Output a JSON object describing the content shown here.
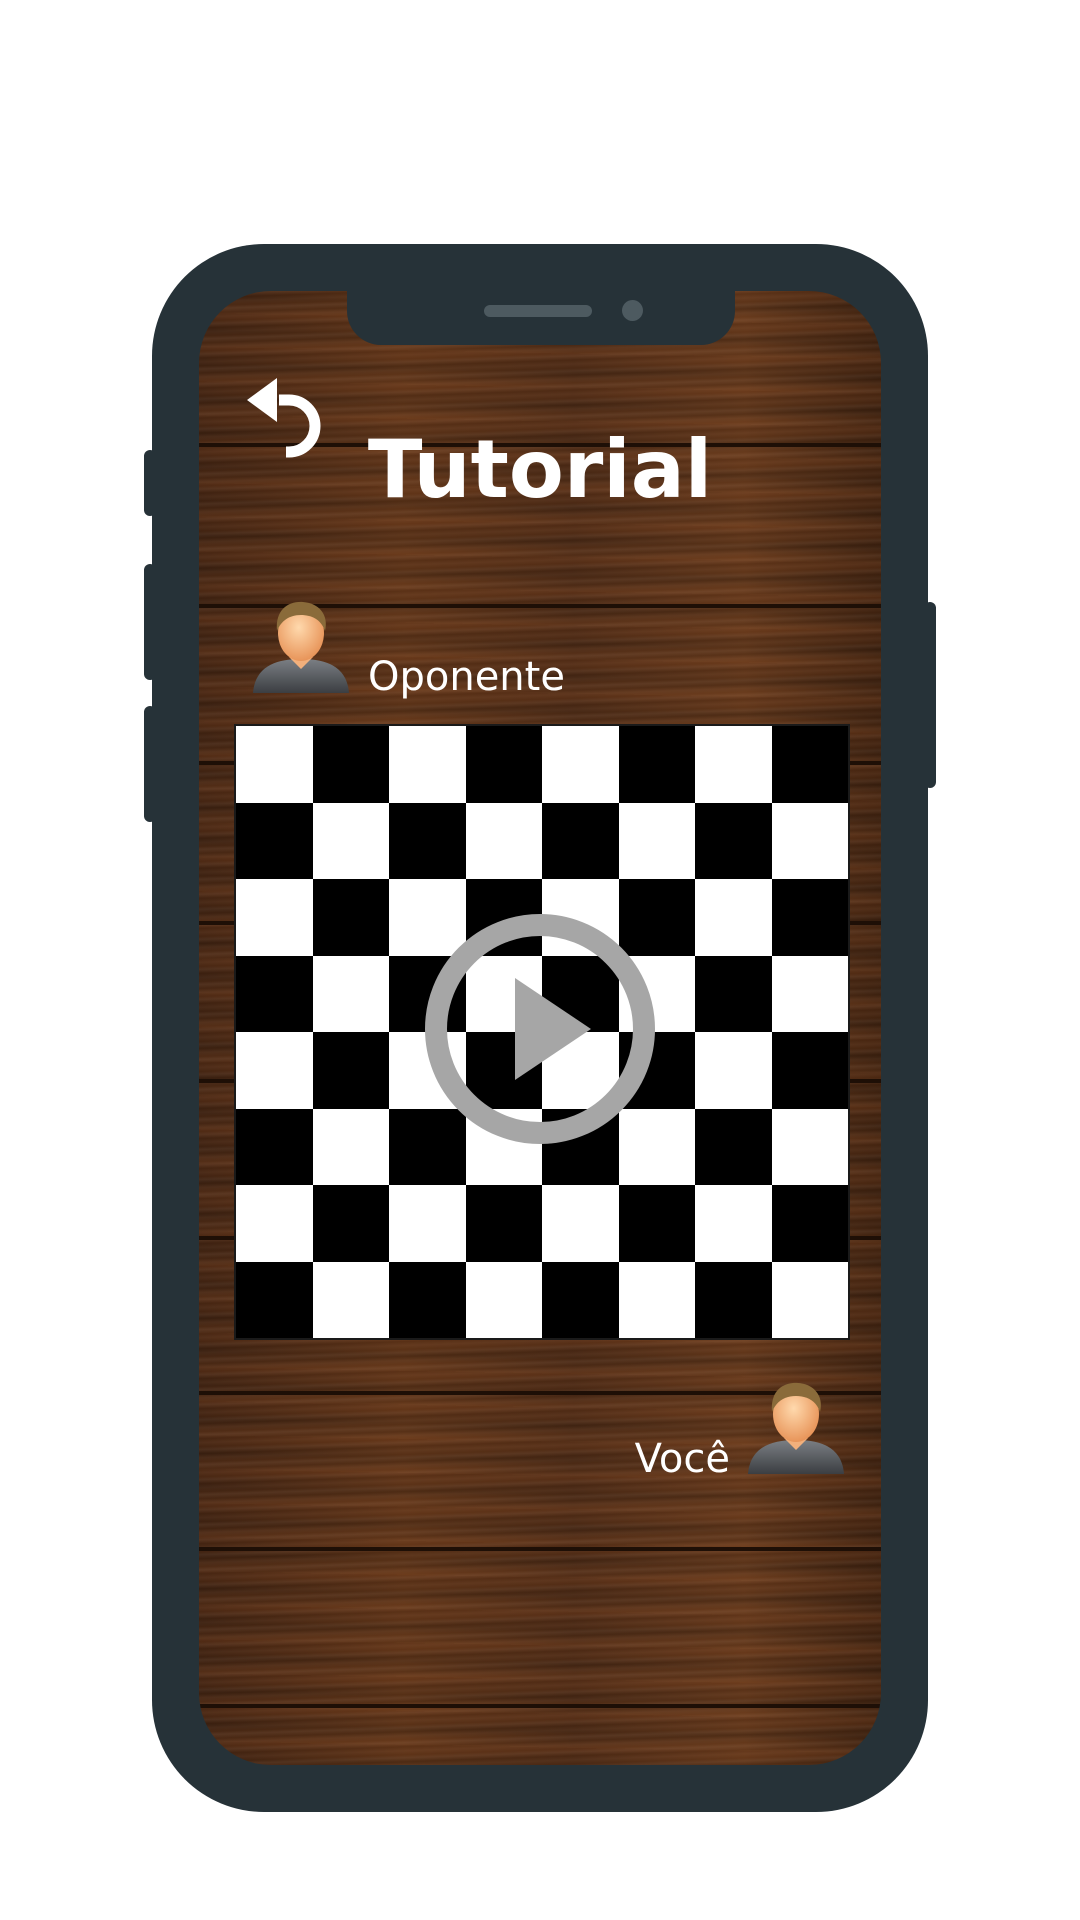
{
  "header": {
    "title": "Tutorial",
    "back_icon": "back-arrow-icon"
  },
  "players": {
    "opponent": {
      "name": "Oponente",
      "icon": "user-avatar-icon"
    },
    "you": {
      "name": "Você",
      "icon": "user-avatar-icon"
    }
  },
  "board": {
    "rows": 8,
    "cols": 8,
    "top_left_square": "light",
    "light_color": "#ffffff",
    "dark_color": "#000000"
  },
  "video": {
    "play_icon": "play-circle-icon",
    "overlay_color": "#a6a6a6"
  },
  "colors": {
    "phone_frame": "#263238",
    "text": "#ffffff",
    "wood": "#4a2a16"
  }
}
